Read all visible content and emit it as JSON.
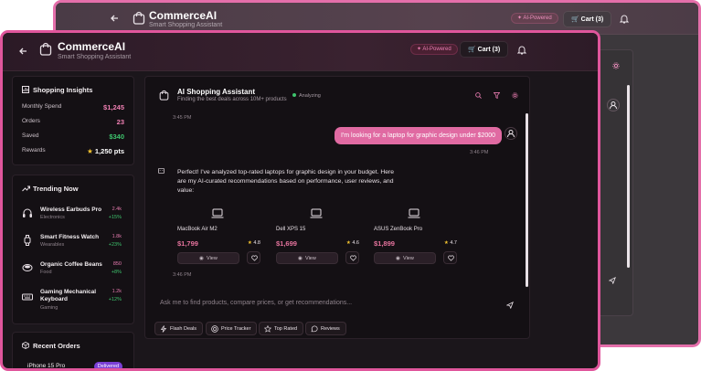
{
  "app": {
    "brand": "CommerceAI",
    "tagline": "Smart Shopping Assistant",
    "ai_badge": "AI-Powered",
    "cart_label": "Cart (3)"
  },
  "insights": {
    "title": "Shopping Insights",
    "rows": [
      {
        "label": "Monthly Spend",
        "value": "$1,245",
        "color": "#ef7fb2"
      },
      {
        "label": "Orders",
        "value": "23",
        "color": "#ef7fb2"
      },
      {
        "label": "Saved",
        "value": "$340",
        "color": "#3ec46d"
      },
      {
        "label": "Rewards",
        "value": "1,250 pts",
        "color": "#ffffff"
      }
    ]
  },
  "trending": {
    "title": "Trending Now",
    "items": [
      {
        "name": "Wireless Earbuds Pro",
        "category": "Electronics",
        "count": "2.4k",
        "change": "+15%",
        "icon": "headphones-icon"
      },
      {
        "name": "Smart Fitness Watch",
        "category": "Wearables",
        "count": "1.8k",
        "change": "+23%",
        "icon": "watch-icon"
      },
      {
        "name": "Organic Coffee Beans",
        "category": "Food",
        "count": "850",
        "change": "+8%",
        "icon": "coffee-icon"
      },
      {
        "name": "Gaming Mechanical Keyboard",
        "category": "Gaming",
        "count": "1.2k",
        "change": "+12%",
        "icon": "keyboard-icon"
      }
    ]
  },
  "orders": {
    "title": "Recent Orders",
    "items": [
      {
        "name": "iPhone 15 Pro",
        "status": "Delivered"
      }
    ]
  },
  "chat": {
    "title": "AI Shopping Assistant",
    "subtitle": "Finding the best deals across 10M+ products",
    "status": "Analyzing",
    "timestamp_1": "3:45 PM",
    "user_message": "I'm looking for a laptop for graphic design under $2000",
    "timestamp_2": "3:46 PM",
    "ai_message": "Perfect! I've analyzed top-rated laptops for graphic design in your budget. Here are my AI-curated recommendations based on performance, user reviews, and value:",
    "timestamp_3": "3:46 PM",
    "products": [
      {
        "name": "MacBook Air M2",
        "price": "$1,799",
        "rating": "4.8",
        "view_label": "View"
      },
      {
        "name": "Dell XPS 15",
        "price": "$1,699",
        "rating": "4.6",
        "view_label": "View"
      },
      {
        "name": "ASUS ZenBook Pro",
        "price": "$1,899",
        "rating": "4.7",
        "view_label": "View"
      }
    ],
    "input_placeholder": "Ask me to find products, compare prices, or get recommendations...",
    "quick_actions": [
      "Flash Deals",
      "Price Tracker",
      "Top Rated",
      "Reviews"
    ]
  },
  "colors": {
    "accent": "#e0569c",
    "price": "#e5739d",
    "positive": "#3ec46d"
  }
}
